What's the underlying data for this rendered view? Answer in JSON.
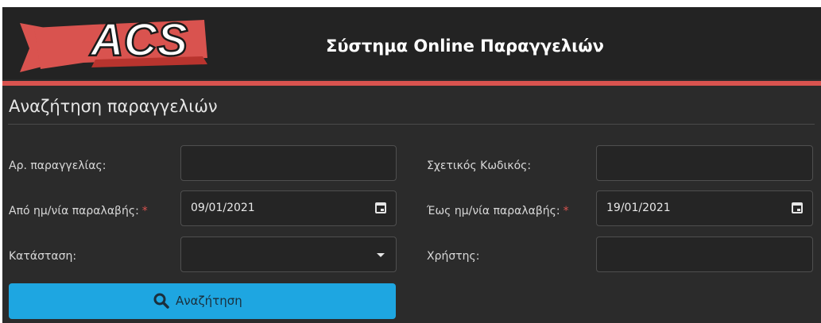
{
  "header": {
    "logo_text": "ACS",
    "title": "Σύστημα Online Παραγγελιών"
  },
  "section": {
    "title": "Αναζήτηση παραγγελιών"
  },
  "form": {
    "order_number": {
      "label": "Αρ. παραγγελίας:",
      "value": ""
    },
    "related_code": {
      "label": "Σχετικός Κωδικός:",
      "value": ""
    },
    "from_date": {
      "label": "Από ημ/νία παραλαβής:",
      "required_mark": "*",
      "value": "09/01/2021"
    },
    "to_date": {
      "label": "Έως ημ/νία παραλαβής:",
      "required_mark": "*",
      "value": "19/01/2021"
    },
    "status": {
      "label": "Κατάσταση:",
      "value": ""
    },
    "user": {
      "label": "Χρήστης:",
      "value": ""
    }
  },
  "search_button": {
    "label": "Αναζήτηση"
  },
  "icons": {
    "search": "search-icon",
    "calendar": "calendar-icon",
    "dropdown": "chevron-down-icon"
  },
  "colors": {
    "accent_red": "#d9534f",
    "button_blue": "#1ea6e1",
    "background": "#2b2b2b",
    "header_bg": "#232323"
  }
}
